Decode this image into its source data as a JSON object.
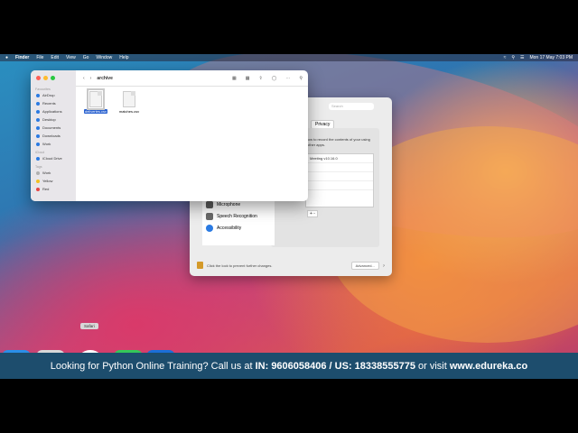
{
  "menubar": {
    "items": [
      "Finder",
      "File",
      "Edit",
      "View",
      "Go",
      "Window",
      "Help"
    ],
    "clock": "Mon 17 May  7:03 PM"
  },
  "finder": {
    "title": "archive",
    "sidebar": {
      "favourites_header": "Favourites",
      "favourites": [
        "AirDrop",
        "Recents",
        "Applications",
        "Desktop",
        "Documents",
        "Downloads",
        "Work"
      ],
      "icloud_header": "iCloud",
      "icloud": [
        "iCloud Drive"
      ],
      "tags_header": "Tags",
      "tags": [
        {
          "label": "Work",
          "color": "#b0b0b0"
        },
        {
          "label": "Yellow",
          "color": "#f3c022"
        },
        {
          "label": "Red",
          "color": "#e64545"
        }
      ]
    },
    "files": [
      {
        "name": "deliveries.csv",
        "selected": true
      },
      {
        "name": "matches.csv",
        "selected": false
      }
    ]
  },
  "prefs": {
    "search_placeholder": "Search",
    "tab": "Privacy",
    "description": "low to record the contents of your using other apps.",
    "app_row": "Meeting v10.16.0",
    "plus_minus": "+ -",
    "list": [
      {
        "label": "Microphone",
        "icon": "microphone-icon",
        "color": "#5a5a5a"
      },
      {
        "label": "Speech Recognition",
        "icon": "waveform-icon",
        "color": "#6a6a6a"
      },
      {
        "label": "Accessibility",
        "icon": "accessibility-icon",
        "color": "#2a7ae2"
      }
    ],
    "lock_text": "Click the lock to prevent further changes.",
    "advanced": "Advanced...",
    "help": "?"
  },
  "dock": {
    "tooltip": "Safari"
  },
  "banner": {
    "prefix": "Looking for Python Online Training? Call us at ",
    "in_label": "IN: 9606058406 / US: 18338555775",
    "middle": " or visit ",
    "site": "www.edureka.co"
  }
}
